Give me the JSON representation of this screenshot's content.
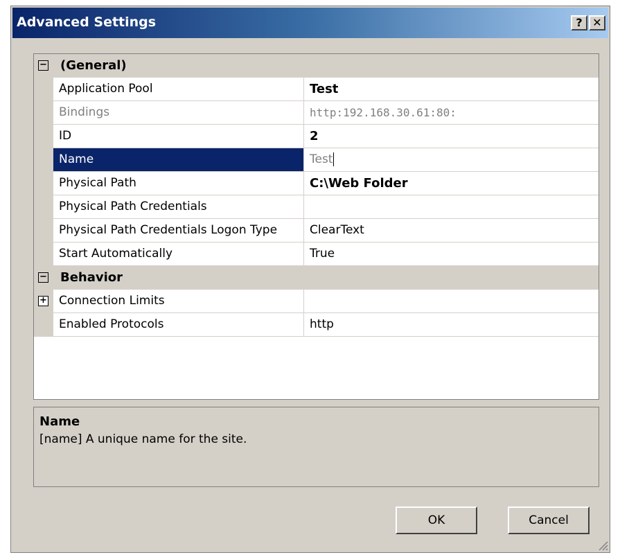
{
  "window": {
    "title": "Advanced Settings",
    "help_label": "?",
    "close_label": "✕"
  },
  "grid": {
    "categories": [
      {
        "label": "(General)",
        "expander": "−",
        "props": [
          {
            "name": "Application Pool",
            "value": "Test"
          },
          {
            "name": "Bindings",
            "value": "http:192.168.30.61:80:"
          },
          {
            "name": "ID",
            "value": "2"
          },
          {
            "name": "Name",
            "value": "Test"
          },
          {
            "name": "Physical Path",
            "value": "C:\\Web Folder"
          },
          {
            "name": "Physical Path Credentials",
            "value": ""
          },
          {
            "name": "Physical Path Credentials Logon Type",
            "value": "ClearText"
          },
          {
            "name": "Start Automatically",
            "value": "True"
          }
        ]
      },
      {
        "label": "Behavior",
        "expander": "−",
        "props": [
          {
            "name": "Connection Limits",
            "value": "",
            "expander": "+"
          },
          {
            "name": "Enabled Protocols",
            "value": "http"
          }
        ]
      }
    ]
  },
  "description": {
    "title": "Name",
    "text": "[name] A unique name for the site."
  },
  "buttons": {
    "ok": "OK",
    "cancel": "Cancel"
  },
  "colors": {
    "selection": "#0a246a",
    "dialog_bg": "#d4d0c8"
  }
}
